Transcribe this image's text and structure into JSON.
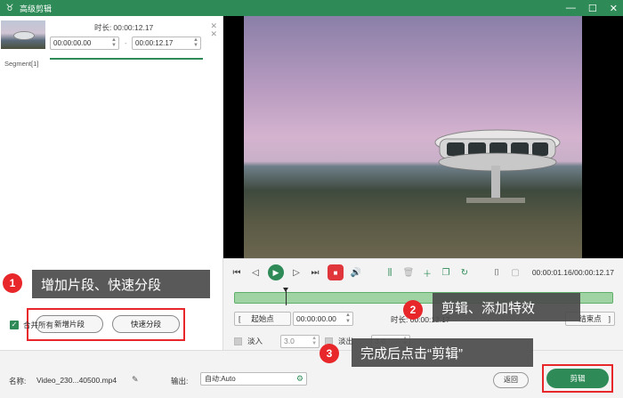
{
  "window": {
    "title": "高级剪辑",
    "min": "—",
    "max": "☐",
    "close": "✕"
  },
  "segment": {
    "duration_label": "时长:",
    "duration_value": "00:00:12.17",
    "start_time": "00:00:00.00",
    "end_time": "00:00:12.17",
    "dash": "-",
    "label": "Segment[1]"
  },
  "callouts": {
    "one": {
      "num": "1",
      "text": "增加片段、快速分段"
    },
    "two": {
      "num": "2",
      "text": "剪辑、添加特效"
    },
    "three": {
      "num": "3",
      "text": "完成后点击“剪辑”"
    }
  },
  "left_buttons": {
    "add_segment": "新增片段",
    "quick_split": "快速分段"
  },
  "merge_all": "合并所有",
  "playback": {
    "time": "00:00:01.16/00:00:12.17"
  },
  "trim": {
    "start_point": "起始点",
    "start_value": "00:00:00.00",
    "duration_label": "时长: 00:00:12.17",
    "end_point": "结束点"
  },
  "fade": {
    "fade_in_label": "淡入",
    "fade_in_value": "3.0",
    "fade_out_label": "淡出",
    "fade_out_value": "3.0"
  },
  "output": {
    "name_label": "名称:",
    "name_value": "Video_230...40500.mp4",
    "output_label": "输出:",
    "output_value": "自动:Auto",
    "cancel_label": "返回",
    "clip_label": "剪辑"
  },
  "colors": {
    "brand_green": "#2e8b57",
    "callout_red": "#e8272b",
    "timeline_green": "#9fd3a4"
  }
}
